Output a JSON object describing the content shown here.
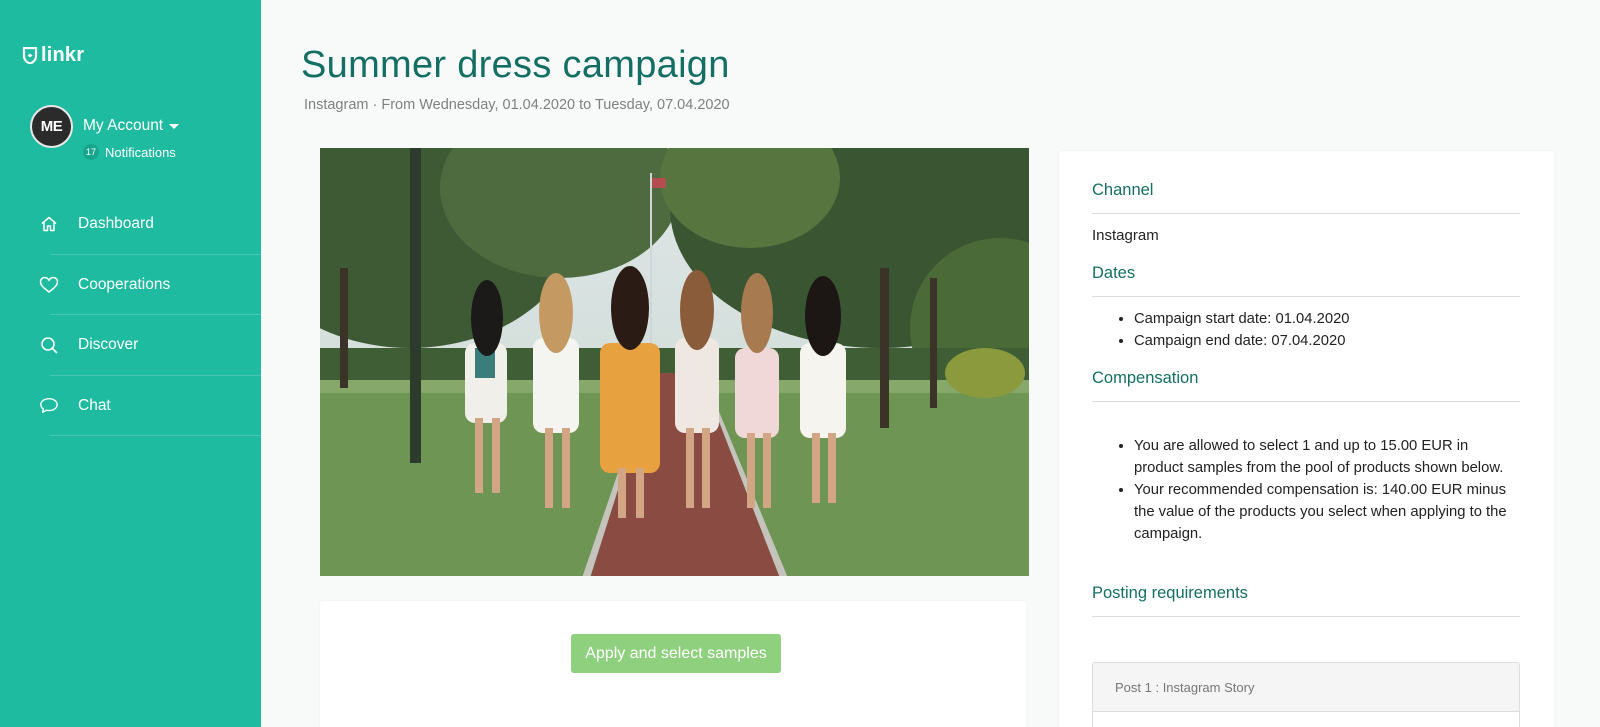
{
  "sidebar": {
    "logo_text": "linkr",
    "account": {
      "avatar_initials": "ME",
      "name": "My Account",
      "notification_count": "17",
      "notification_label": "Notifications"
    },
    "nav": [
      {
        "label": "Dashboard",
        "icon": "home-icon"
      },
      {
        "label": "Cooperations",
        "icon": "heart-icon"
      },
      {
        "label": "Discover",
        "icon": "search-icon"
      },
      {
        "label": "Chat",
        "icon": "chat-bubble-icon"
      }
    ]
  },
  "campaign": {
    "title": "Summer dress campaign",
    "subtitle": "Instagram · From Wednesday, 01.04.2020 to Tuesday, 07.04.2020",
    "apply_button": "Apply and select samples"
  },
  "details": {
    "channel": {
      "heading": "Channel",
      "value": "Instagram"
    },
    "dates": {
      "heading": "Dates",
      "items": [
        "Campaign start date: 01.04.2020",
        "Campaign end date: 07.04.2020"
      ]
    },
    "compensation": {
      "heading": "Compensation",
      "items": [
        "You are allowed to select 1 and up to 15.00 EUR in product samples from the pool of products shown below.",
        "Your recommended compensation is: 140.00 EUR minus the value of the products you select when applying to the campaign."
      ]
    },
    "posting": {
      "heading": "Posting requirements",
      "post_label": "Post 1 : Instagram Story"
    }
  },
  "colors": {
    "sidebar_bg": "#1fbba0",
    "heading_teal": "#136f63",
    "button_green": "#8ed07d"
  }
}
